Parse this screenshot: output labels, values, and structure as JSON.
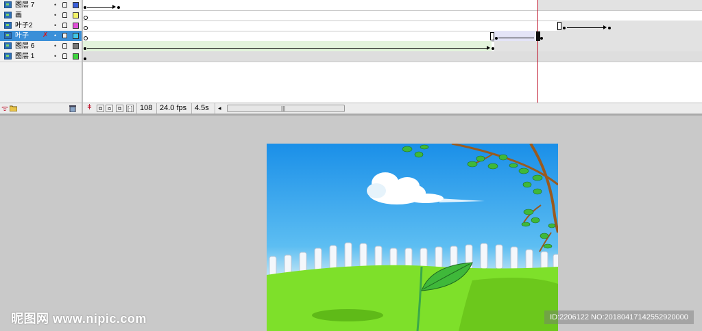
{
  "layers": [
    {
      "name": "图层 7",
      "color": "#3a5fd9",
      "selected": false
    },
    {
      "name": "画",
      "color": "#f4f46a",
      "selected": false
    },
    {
      "name": "叶子2",
      "color": "#e04fd8",
      "selected": false
    },
    {
      "name": "叶子",
      "color": "#41c8e8",
      "selected": true
    },
    {
      "name": "图层 6",
      "color": "#777777",
      "selected": false
    },
    {
      "name": "图层 1",
      "color": "#3fd43f",
      "selected": false
    }
  ],
  "layer_controls": {
    "visible_icon": "eye-dot-icon",
    "lock_icon": "lock-icon",
    "edit_icon": "pencil-crossed-icon"
  },
  "status": {
    "current_frame": "108",
    "frame_rate": "24.0 fps",
    "elapsed": "4.5s"
  },
  "watermark": {
    "left_text": "昵图网 www.nipic.com",
    "right_text": "ID:2206122 NO:20180417142552920000"
  },
  "colors": {
    "playhead": "#c0182f",
    "selected_layer": "#3a8fd8",
    "sky_top": "#1a8fe8",
    "grass": "#7ee02a"
  }
}
